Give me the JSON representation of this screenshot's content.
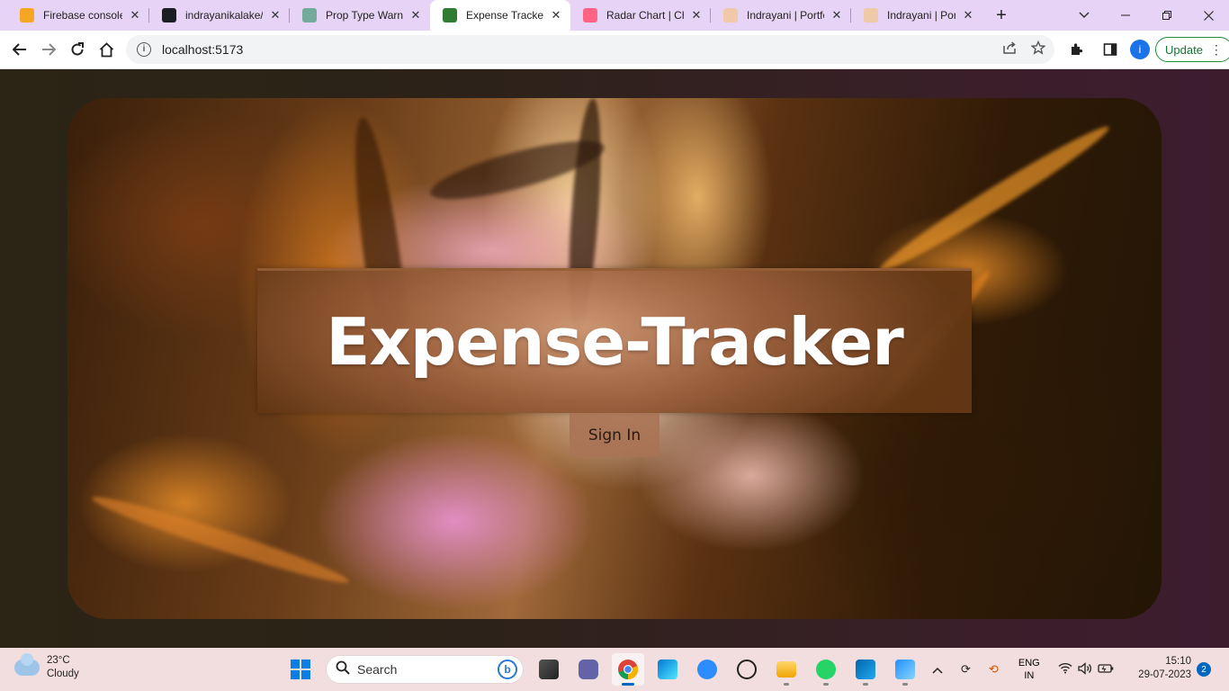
{
  "browser": {
    "tabs": [
      {
        "title": "Firebase console",
        "icon": "firebase-icon",
        "color": "#f5a623",
        "active": false
      },
      {
        "title": "indrayanikalake/e",
        "icon": "github-icon",
        "color": "#1b1f23",
        "active": false
      },
      {
        "title": "Prop Type Warnin",
        "icon": "chatgpt-icon",
        "color": "#74aa9c",
        "active": false
      },
      {
        "title": "Expense Tracker",
        "icon": "app-icon",
        "color": "#2e7d32",
        "active": true
      },
      {
        "title": "Radar Chart | Cha",
        "icon": "chartjs-icon",
        "color": "#ff6384",
        "active": false
      },
      {
        "title": "Indrayani | Portfo",
        "icon": "portfolio-icon",
        "color": "#f0c9a8",
        "active": false
      },
      {
        "title": "Indrayani | Portfo",
        "icon": "portfolio-icon",
        "color": "#f0c9a8",
        "active": false
      }
    ],
    "close_glyph": "✕",
    "new_tab_glyph": "+",
    "address": "localhost:5173",
    "update_label": "Update",
    "profile_initial": "i"
  },
  "page": {
    "title": "Expense-Tracker",
    "signin_label": "Sign In"
  },
  "taskbar": {
    "weather": {
      "temp": "23°C",
      "condition": "Cloudy"
    },
    "search_placeholder": "Search",
    "lang_top": "ENG",
    "lang_bottom": "IN",
    "time": "15:10",
    "date": "29-07-2023",
    "notifications": "2"
  }
}
